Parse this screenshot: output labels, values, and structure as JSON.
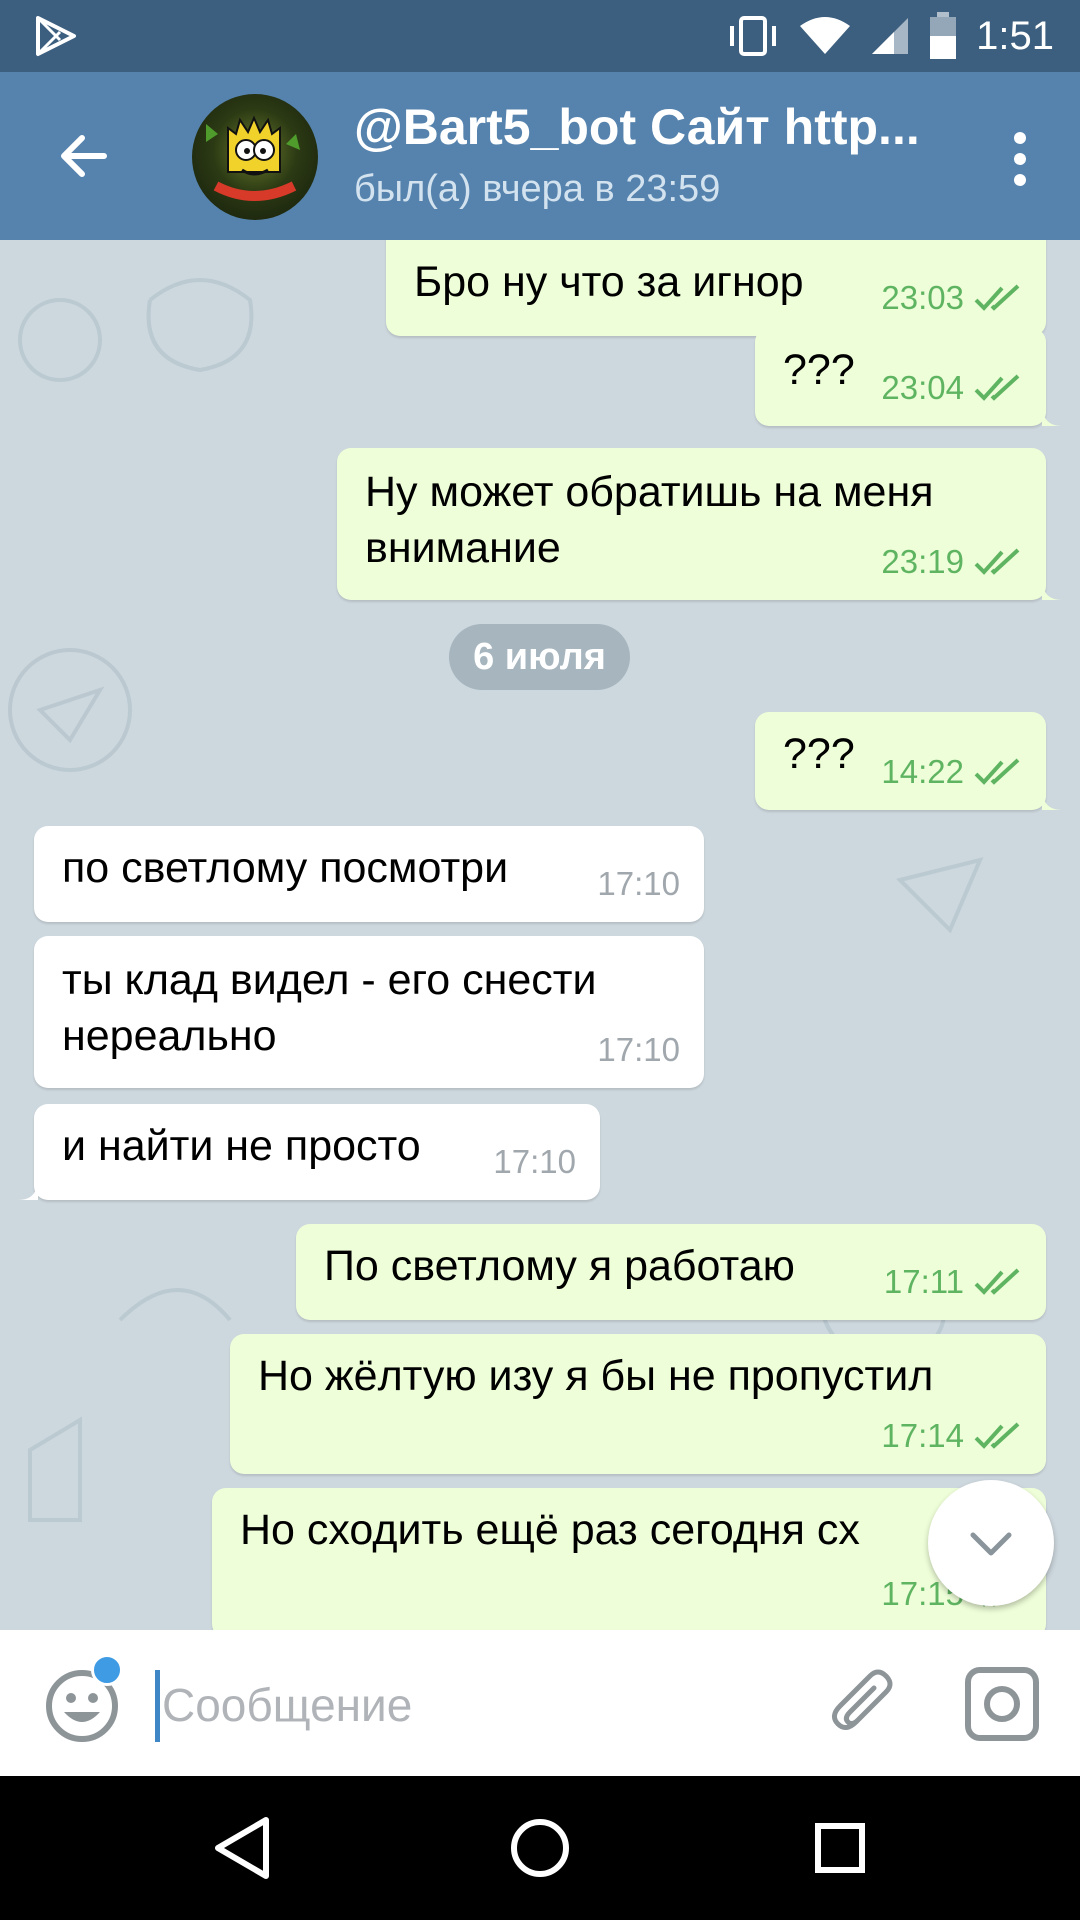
{
  "status_bar": {
    "time": "1:51"
  },
  "header": {
    "title": "@Bart5_bot Сайт http...",
    "status": "был(а) вчера в 23:59"
  },
  "messages": [
    {
      "dir": "out",
      "text": "Бро ну что за игнор",
      "time": "23:03",
      "read": true
    },
    {
      "dir": "out",
      "text": "???",
      "time": "23:04",
      "read": true
    },
    {
      "dir": "out",
      "text_lines": [
        "Ну может обратишь на меня",
        "внимание"
      ],
      "time": "23:19",
      "read": true
    },
    {
      "dir": "out",
      "text": "???",
      "time": "14:22",
      "read": true
    },
    {
      "dir": "in",
      "text": "по светлому посмотри",
      "time": "17:10"
    },
    {
      "dir": "in",
      "text_lines": [
        "ты клад видел - его снести",
        "нереально"
      ],
      "time": "17:10"
    },
    {
      "dir": "in",
      "text": "и найти не просто",
      "time": "17:10"
    },
    {
      "dir": "out",
      "text": "По светлому я работаю",
      "time": "17:11",
      "read": true
    },
    {
      "dir": "out",
      "text": "Но жёлтую изу я бы не пропустил",
      "time": "17:14",
      "read": true
    },
    {
      "dir": "out",
      "text": "Но сходить ещё раз сегодня сх",
      "time": "17:15",
      "read": true
    }
  ],
  "date_separator": "6 июля",
  "input": {
    "placeholder": "Сообщение",
    "value": ""
  },
  "colors": {
    "header": "#5583ad",
    "status_bar": "#3d5f7f",
    "outgoing_bubble": "#eefed8",
    "incoming_bubble": "#ffffff",
    "read_check": "#5fb462",
    "accent": "#3f9be3"
  },
  "icons": {
    "back": "arrow-left-icon",
    "more": "more-vertical-icon",
    "emoji": "smiley-icon",
    "attach": "paperclip-icon",
    "camera": "instagram-camera-icon",
    "scroll": "chevron-down-icon"
  }
}
